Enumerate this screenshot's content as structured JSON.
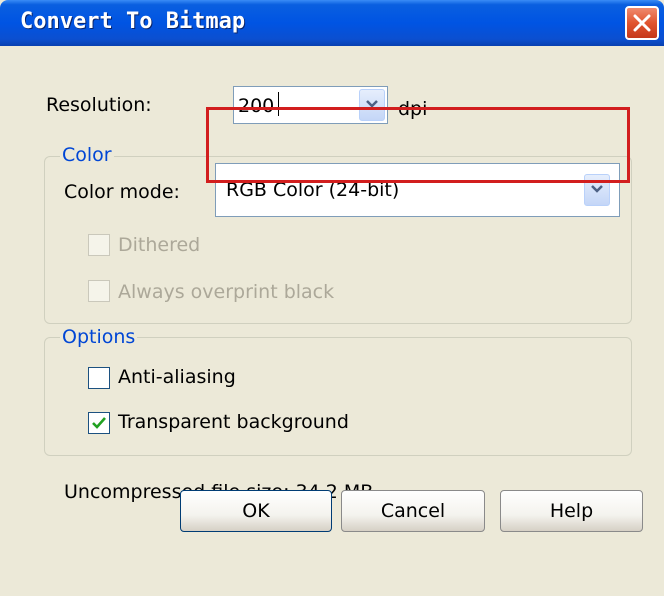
{
  "window": {
    "title": "Convert To Bitmap"
  },
  "resolution": {
    "label": "Resolution:",
    "value": "200",
    "unit": "dpi"
  },
  "color_group": {
    "legend": "Color",
    "color_mode_label": "Color mode:",
    "color_mode_value": "RGB Color (24-bit)",
    "dithered": {
      "label": "Dithered",
      "checked": false,
      "enabled": false
    },
    "overprint": {
      "label": "Always overprint black",
      "checked": false,
      "enabled": false
    }
  },
  "options_group": {
    "legend": "Options",
    "anti_aliasing": {
      "label": "Anti-aliasing",
      "checked": false
    },
    "transparent_background": {
      "label": "Transparent background",
      "checked": true
    }
  },
  "file_size": "Uncompressed file size: 34.2 MB",
  "buttons": {
    "ok": "OK",
    "cancel": "Cancel",
    "help": "Help"
  },
  "colors": {
    "titlebar": "#0054e3",
    "dialog_bg": "#ece9d8",
    "legend_text": "#0046d5",
    "highlight": "#d21e1e",
    "check_green": "#21a121"
  },
  "icons": {
    "close": "close-icon",
    "dropdown": "chevron-down-icon",
    "check": "check-icon"
  }
}
